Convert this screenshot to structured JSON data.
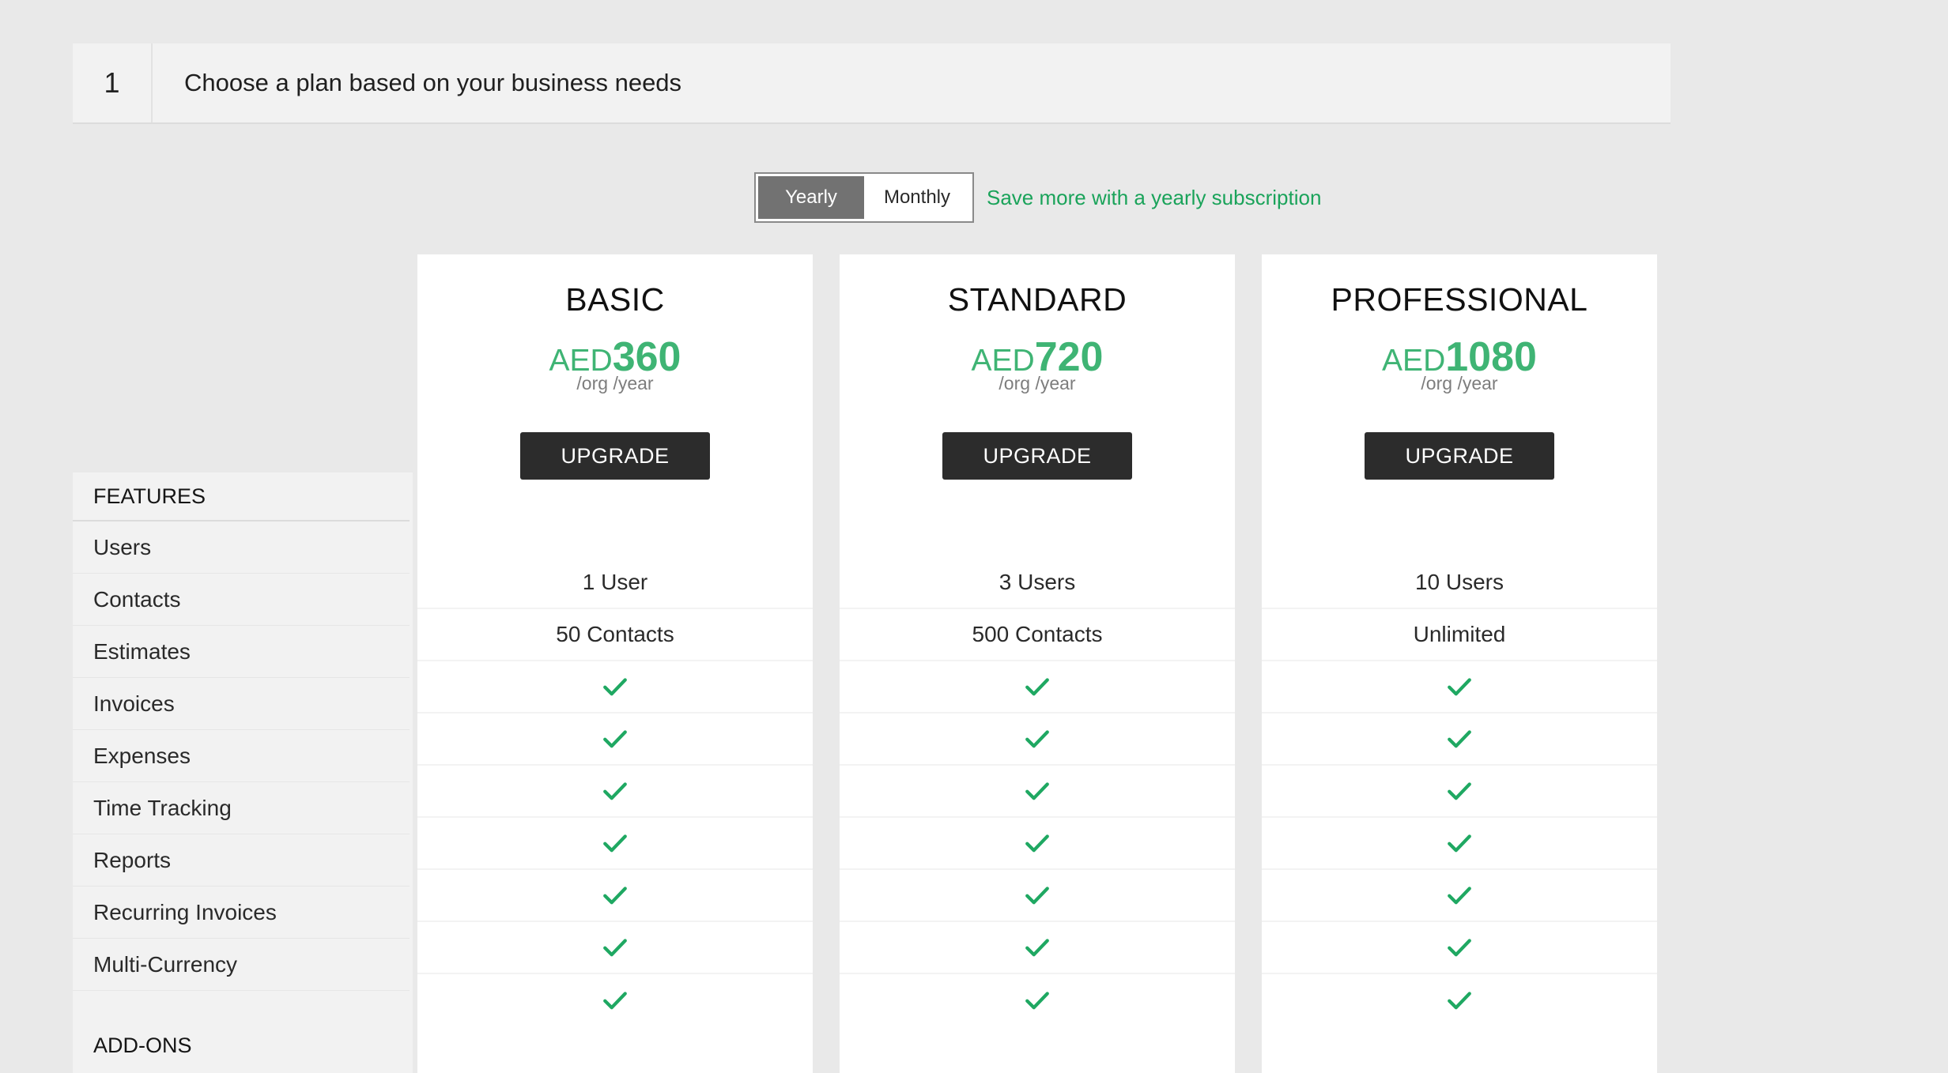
{
  "step": {
    "number": "1",
    "title": "Choose a plan based on your business needs"
  },
  "billing": {
    "options": [
      "Yearly",
      "Monthly"
    ],
    "selected": "Yearly",
    "savings_text": "Save more with a yearly subscription"
  },
  "features": {
    "heading": "FEATURES",
    "items": [
      "Users",
      "Contacts",
      "Estimates",
      "Invoices",
      "Expenses",
      "Time Tracking",
      "Reports",
      "Recurring Invoices",
      "Multi-Currency"
    ]
  },
  "addons": {
    "heading": "ADD-ONS"
  },
  "plans": [
    {
      "name": "BASIC",
      "currency": "AED",
      "amount": "360",
      "period": "/org /year",
      "button_label": "UPGRADE",
      "users": "1 User",
      "contacts": "50 Contacts"
    },
    {
      "name": "STANDARD",
      "currency": "AED",
      "amount": "720",
      "period": "/org /year",
      "button_label": "UPGRADE",
      "users": "3 Users",
      "contacts": "500 Contacts"
    },
    {
      "name": "PROFESSIONAL",
      "currency": "AED",
      "amount": "1080",
      "period": "/org /year",
      "button_label": "UPGRADE",
      "users": "10 Users",
      "contacts": "Unlimited"
    }
  ],
  "icons": {
    "included": "check-icon"
  },
  "colors": {
    "accent_green": "#3fb474",
    "savings_green": "#1aa35a",
    "button_dark": "#2c2c2c",
    "toggle_active": "#727272"
  }
}
